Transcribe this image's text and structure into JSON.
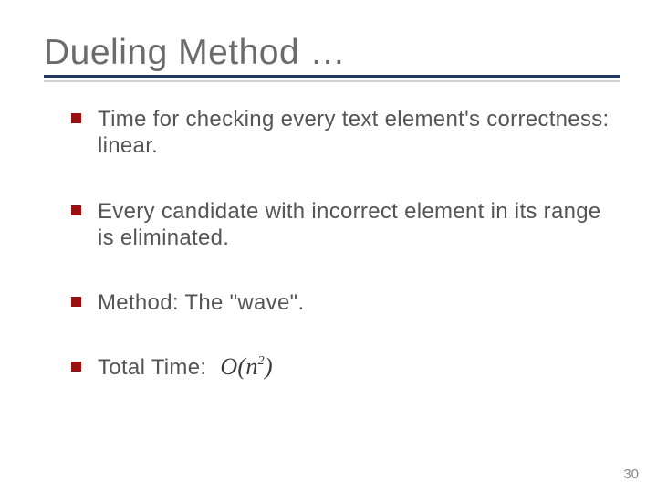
{
  "slide": {
    "title": "Dueling Method …",
    "bullets": [
      {
        "text": "Time for checking every text element's correctness: linear."
      },
      {
        "text": "Every candidate with incorrect element in its range is eliminated."
      },
      {
        "text": "Method: The \"wave\"."
      },
      {
        "text": "Total Time:",
        "formula": "O(n²)"
      }
    ],
    "page_number": "30"
  }
}
